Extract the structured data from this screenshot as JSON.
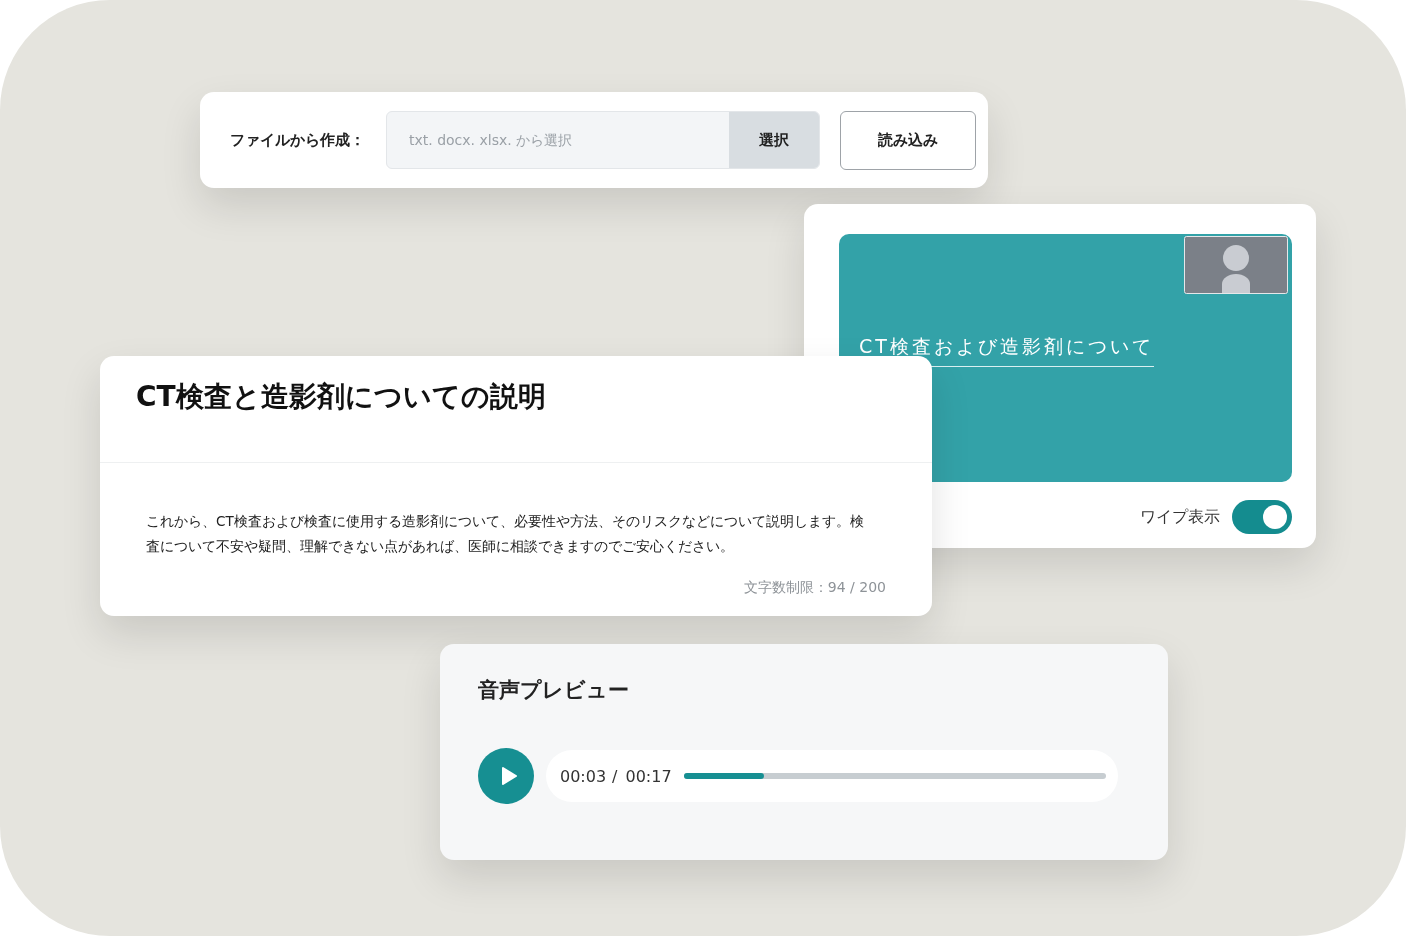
{
  "file_import": {
    "label": "ファイルから作成：",
    "placeholder": "txt. docx. xlsx. から選択",
    "select_button": "選択",
    "load_button": "読み込み"
  },
  "video_preview": {
    "slide_title": "CT検査および造影剤について",
    "wipe_label": "ワイプ表示",
    "wipe_on": true
  },
  "description": {
    "title": "CT検査と造影剤についての説明",
    "body": "これから、CT検査および検査に使用する造影剤について、必要性や方法、そのリスクなどについて説明します。検査について不安や疑問、理解できない点があれば、医師に相談できますのでご安心ください。",
    "char_limit": "文字数制限：94 / 200"
  },
  "audio_preview": {
    "title": "音声プレビュー",
    "current_time": "00:03",
    "separator": "/",
    "total_time": "00:17",
    "level": 0.19
  }
}
